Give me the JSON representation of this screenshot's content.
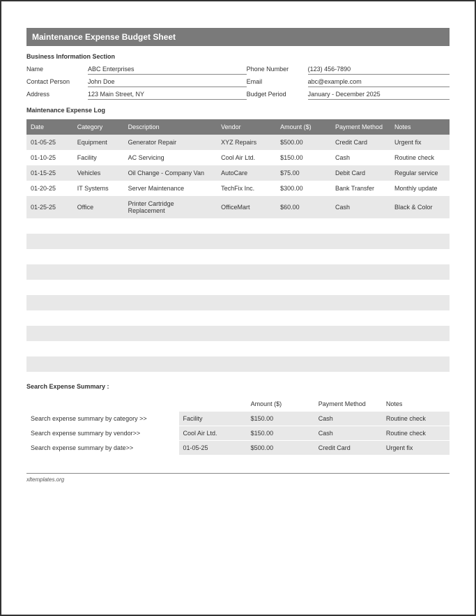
{
  "title": "Maintenance Expense Budget Sheet",
  "business_section_label": "Business Information Section",
  "business_info": {
    "name_label": "Name",
    "name_value": "ABC Enterprises",
    "phone_label": "Phone Number",
    "phone_value": "(123) 456-7890",
    "contact_label": "Contact Person",
    "contact_value": "John Doe",
    "email_label": "Email",
    "email_value": "abc@example.com",
    "address_label": "Address",
    "address_value": "123 Main Street, NY",
    "budget_period_label": "Budget Period",
    "budget_period_value": "January - December 2025"
  },
  "log_section_label": "Maintenance Expense Log",
  "log_headers": {
    "date": "Date",
    "category": "Category",
    "description": "Description",
    "vendor": "Vendor",
    "amount": "Amount ($)",
    "payment": "Payment Method",
    "notes": "Notes"
  },
  "log_rows": [
    {
      "date": "01-05-25",
      "category": "Equipment",
      "description": "Generator Repair",
      "vendor": "XYZ Repairs",
      "amount": "$500.00",
      "payment": "Credit Card",
      "notes": "Urgent fix"
    },
    {
      "date": "01-10-25",
      "category": "Facility",
      "description": "AC Servicing",
      "vendor": "Cool Air Ltd.",
      "amount": "$150.00",
      "payment": "Cash",
      "notes": "Routine check"
    },
    {
      "date": "01-15-25",
      "category": "Vehicles",
      "description": "Oil Change - Company Van",
      "vendor": "AutoCare",
      "amount": "$75.00",
      "payment": "Debit Card",
      "notes": "Regular service"
    },
    {
      "date": "01-20-25",
      "category": "IT Systems",
      "description": "Server Maintenance",
      "vendor": "TechFix Inc.",
      "amount": "$300.00",
      "payment": "Bank Transfer",
      "notes": "Monthly update"
    },
    {
      "date": "01-25-25",
      "category": "Office",
      "description": "Printer Cartridge Replacement",
      "vendor": "OfficeMart",
      "amount": "$60.00",
      "payment": "Cash",
      "notes": "Black & Color"
    },
    {
      "date": "",
      "category": "",
      "description": "",
      "vendor": "",
      "amount": "",
      "payment": "",
      "notes": ""
    },
    {
      "date": "",
      "category": "",
      "description": "",
      "vendor": "",
      "amount": "",
      "payment": "",
      "notes": ""
    },
    {
      "date": "",
      "category": "",
      "description": "",
      "vendor": "",
      "amount": "",
      "payment": "",
      "notes": ""
    },
    {
      "date": "",
      "category": "",
      "description": "",
      "vendor": "",
      "amount": "",
      "payment": "",
      "notes": ""
    },
    {
      "date": "",
      "category": "",
      "description": "",
      "vendor": "",
      "amount": "",
      "payment": "",
      "notes": ""
    },
    {
      "date": "",
      "category": "",
      "description": "",
      "vendor": "",
      "amount": "",
      "payment": "",
      "notes": ""
    },
    {
      "date": "",
      "category": "",
      "description": "",
      "vendor": "",
      "amount": "",
      "payment": "",
      "notes": ""
    },
    {
      "date": "",
      "category": "",
      "description": "",
      "vendor": "",
      "amount": "",
      "payment": "",
      "notes": ""
    },
    {
      "date": "",
      "category": "",
      "description": "",
      "vendor": "",
      "amount": "",
      "payment": "",
      "notes": ""
    },
    {
      "date": "",
      "category": "",
      "description": "",
      "vendor": "",
      "amount": "",
      "payment": "",
      "notes": ""
    }
  ],
  "summary_title": "Search Expense Summary :",
  "summary_headers": {
    "blank": "",
    "value": "",
    "amount": "Amount ($)",
    "payment": "Payment Method",
    "notes": "Notes"
  },
  "summary_rows": [
    {
      "label": "Search expense summary by category >>",
      "value": "Facility",
      "amount": "$150.00",
      "payment": "Cash",
      "notes": "Routine check"
    },
    {
      "label": "Search expense summary by vendor>>",
      "value": "Cool Air Ltd.",
      "amount": "$150.00",
      "payment": "Cash",
      "notes": "Routine check"
    },
    {
      "label": "Search expense summary by date>>",
      "value": "01-05-25",
      "amount": "$500.00",
      "payment": "Credit Card",
      "notes": "Urgent fix"
    }
  ],
  "footer_text": "xltemplates.org"
}
